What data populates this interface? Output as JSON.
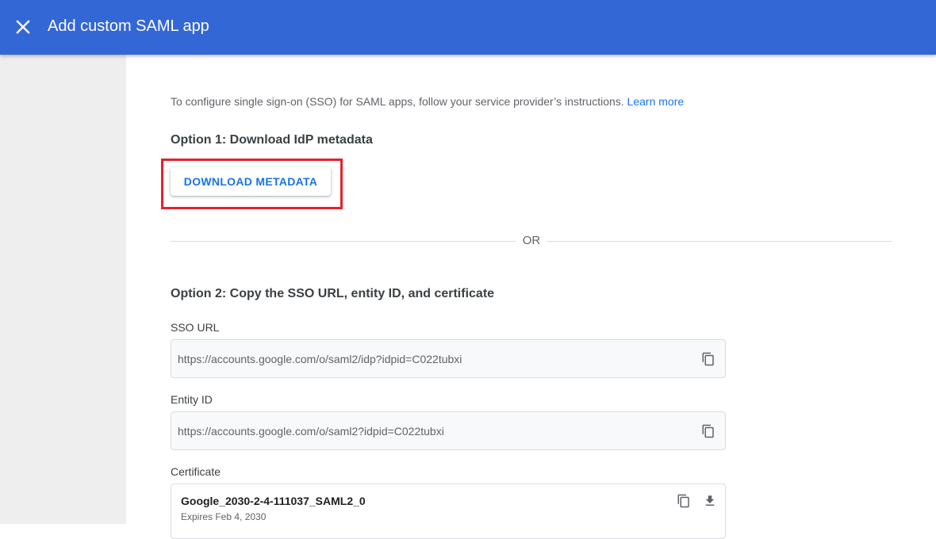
{
  "header": {
    "title": "Add custom SAML app",
    "background": "#3367d6"
  },
  "intro": {
    "text": "To configure single sign-on (SSO) for SAML apps, follow your service provider’s instructions.",
    "link_label": "Learn more"
  },
  "option1": {
    "title": "Option 1: Download IdP metadata",
    "button_label": "DOWNLOAD METADATA"
  },
  "divider": {
    "label": "OR"
  },
  "option2": {
    "title": "Option 2: Copy the SSO URL, entity ID, and certificate",
    "sso_url": {
      "label": "SSO URL",
      "value": "https://accounts.google.com/o/saml2/idp?idpid=C022tubxi"
    },
    "entity_id": {
      "label": "Entity ID",
      "value": "https://accounts.google.com/o/saml2?idpid=C022tubxi"
    },
    "certificate": {
      "label": "Certificate",
      "name": "Google_2030-2-4-111037_SAML2_0",
      "expires": "Expires Feb 4, 2030"
    }
  },
  "icons": {
    "close": "close-icon",
    "copy": "copy-icon",
    "download": "download-icon"
  },
  "colors": {
    "accent": "#1a73e8",
    "highlight": "#e8212b"
  }
}
